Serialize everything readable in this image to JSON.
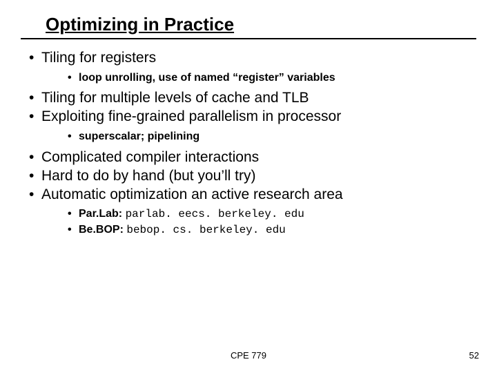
{
  "title": "Optimizing in Practice",
  "bullets": {
    "b1": "Tiling for registers",
    "b1_sub1": "loop unrolling, use of named “register” variables",
    "b2": "Tiling for multiple levels of cache and TLB",
    "b3": "Exploiting fine-grained parallelism in processor",
    "b3_sub1": "superscalar; pipelining",
    "b4": "Complicated compiler interactions",
    "b5": "Hard to do by hand (but you’ll try)",
    "b6": "Automatic optimization an active research area",
    "b6_sub1_label": "Par.Lab: ",
    "b6_sub1_url": "parlab. eecs. berkeley. edu",
    "b6_sub2_label": "Be.BOP: ",
    "b6_sub2_url": "bebop. cs. berkeley. edu"
  },
  "footer": {
    "course": "CPE 779",
    "page": "52"
  }
}
